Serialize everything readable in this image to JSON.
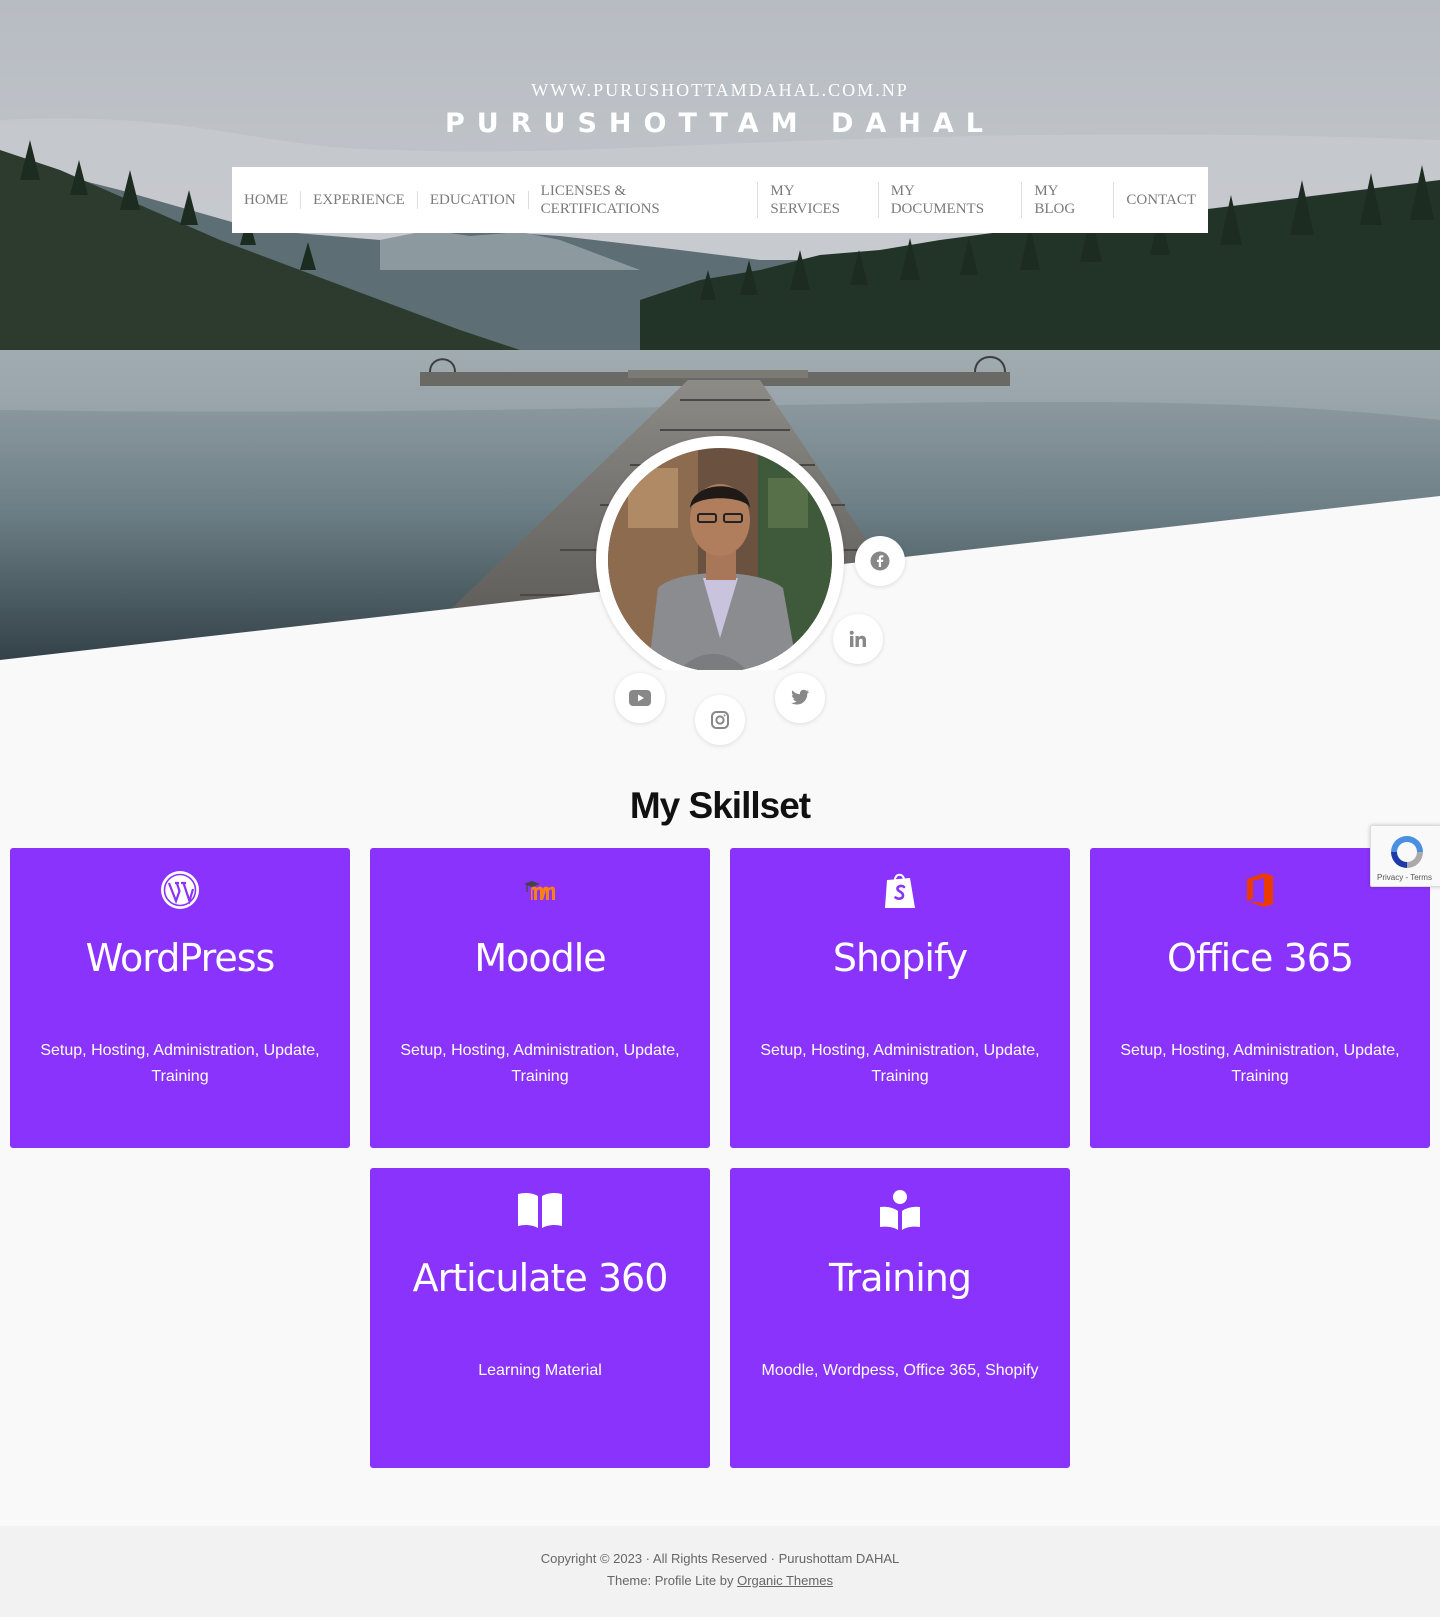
{
  "header": {
    "site_url": "WWW.PURUSHOTTAMDAHAL.COM.NP",
    "site_title": "PURUSHOTTAM DAHAL"
  },
  "nav": {
    "items": [
      {
        "label": "HOME"
      },
      {
        "label": "EXPERIENCE"
      },
      {
        "label": "EDUCATION"
      },
      {
        "label": "LICENSES & CERTIFICATIONS"
      },
      {
        "label": "MY SERVICES"
      },
      {
        "label": "MY DOCUMENTS"
      },
      {
        "label": "MY BLOG"
      },
      {
        "label": "CONTACT"
      }
    ]
  },
  "social": [
    "facebook-icon",
    "linkedin-icon",
    "youtube-icon",
    "instagram-icon",
    "twitter-icon"
  ],
  "skills": {
    "title": "My Skillset",
    "cards": [
      {
        "title": "WordPress",
        "desc": "Setup, Hosting, Administration, Update, Training",
        "icon": "wordpress-icon"
      },
      {
        "title": "Moodle",
        "desc": "Setup, Hosting, Administration, Update, Training",
        "icon": "moodle-icon"
      },
      {
        "title": "Shopify",
        "desc": "Setup, Hosting, Administration, Update, Training",
        "icon": "shopify-icon"
      },
      {
        "title": "Office 365",
        "desc": "Setup, Hosting, Administration, Update, Training",
        "icon": "office-365-icon"
      },
      {
        "title": "Articulate 360",
        "desc": "Learning Material",
        "icon": "open-book-icon"
      },
      {
        "title": "Training",
        "desc": "Moodle, Wordpess, Office 365, Shopify",
        "icon": "reader-icon"
      }
    ]
  },
  "recaptcha": {
    "links": "Privacy - Terms"
  },
  "footer": {
    "copyright": "Copyright © 2023 · All Rights Reserved · Purushottam DAHAL",
    "theme_prefix": "Theme: Profile Lite by ",
    "theme_link": "Organic Themes"
  },
  "colors": {
    "card_bg": "#8a33fc",
    "page_bg": "#f9f9f9"
  }
}
